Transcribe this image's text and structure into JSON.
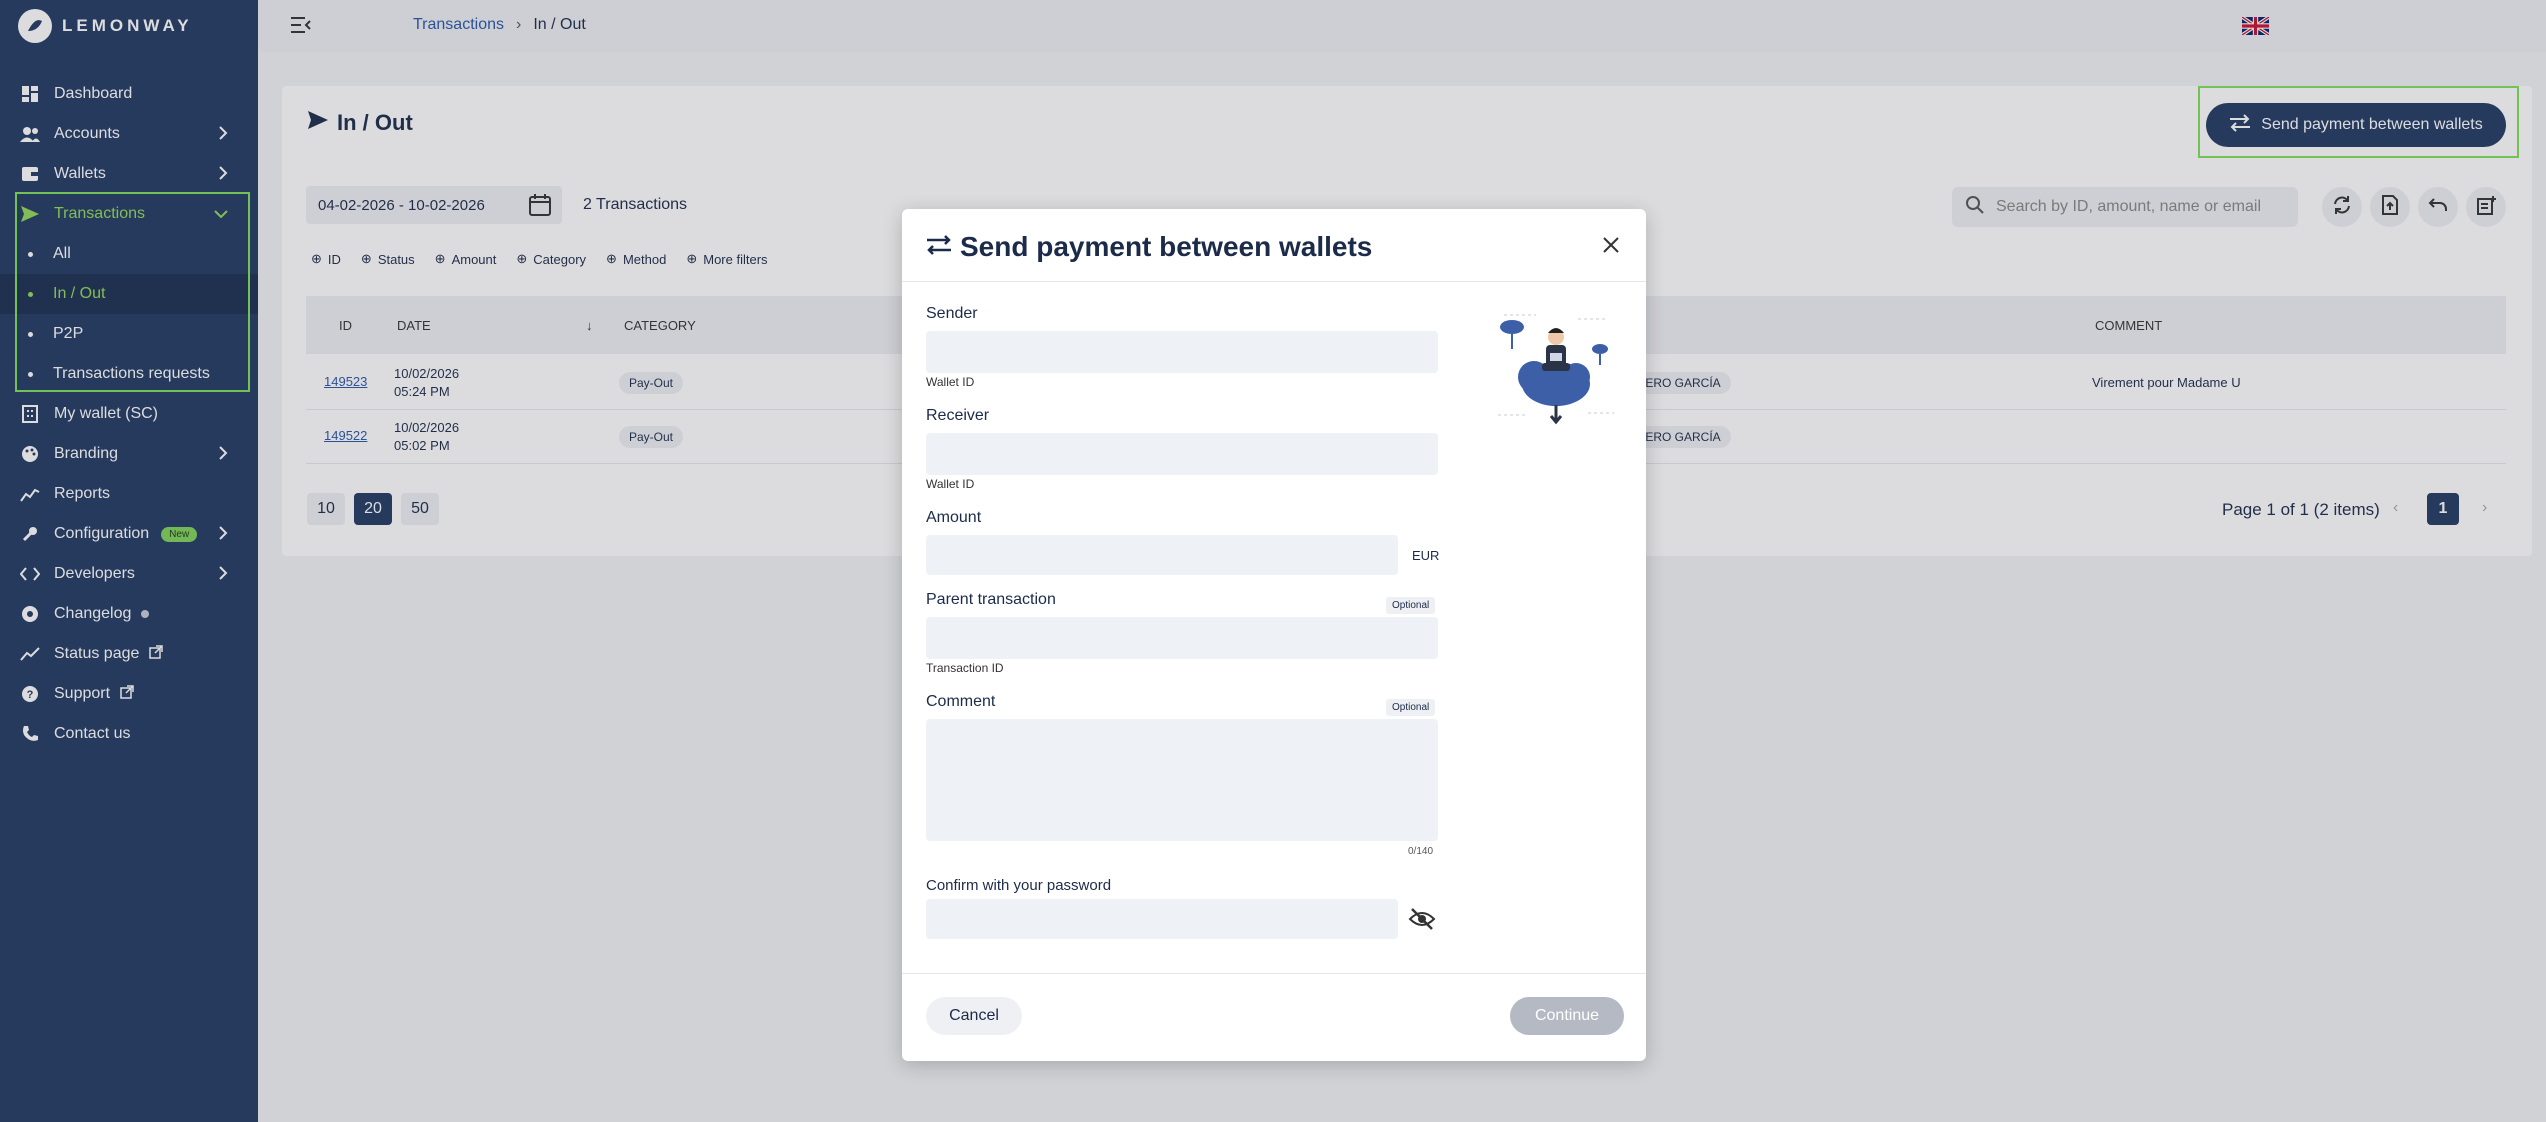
{
  "brand": {
    "name": "LEMONWAY"
  },
  "sidebar": {
    "items": [
      {
        "label": "Dashboard"
      },
      {
        "label": "Accounts"
      },
      {
        "label": "Wallets"
      },
      {
        "label": "Transactions"
      },
      {
        "label": "My wallet (SC)"
      },
      {
        "label": "Branding"
      },
      {
        "label": "Reports"
      },
      {
        "label": "Configuration",
        "badge": "New"
      },
      {
        "label": "Developers"
      },
      {
        "label": "Changelog"
      },
      {
        "label": "Status page"
      },
      {
        "label": "Support"
      },
      {
        "label": "Contact us"
      }
    ],
    "sub_items": [
      {
        "label": "All"
      },
      {
        "label": "In / Out"
      },
      {
        "label": "P2P"
      },
      {
        "label": "Transactions requests"
      }
    ],
    "accent_color": "#93d95a"
  },
  "breadcrumb": {
    "parent": "Transactions",
    "current": "In / Out"
  },
  "page": {
    "title": "In / Out",
    "send_button": "Send payment between wallets",
    "date_range": "04-02-2026 - 10-02-2026",
    "transaction_count": "2 Transactions",
    "search_placeholder": "Search by ID, amount, name or email",
    "filters": [
      "ID",
      "Status",
      "Amount",
      "Category",
      "Method",
      "More filters"
    ]
  },
  "table": {
    "headers": {
      "id": "ID",
      "date": "DATE",
      "category": "CATEGORY",
      "comment": "COMMENT"
    },
    "rows": [
      {
        "id": "149523",
        "date": "10/02/2026",
        "time": "05:24 PM",
        "category": "Pay-Out",
        "name": "OMERO GARCÍA",
        "comment": "Virement pour Madame U"
      },
      {
        "id": "149522",
        "date": "10/02/2026",
        "time": "05:02 PM",
        "category": "Pay-Out",
        "name": "OMERO GARCÍA",
        "comment": ""
      }
    ]
  },
  "pagination": {
    "sizes": [
      "10",
      "20",
      "50"
    ],
    "info": "Page 1 of 1 (2 items)",
    "current": "1"
  },
  "modal": {
    "title": "Send payment between wallets",
    "sender_label": "Sender",
    "sender_hint": "Wallet ID",
    "receiver_label": "Receiver",
    "receiver_hint": "Wallet ID",
    "amount_label": "Amount",
    "currency": "EUR",
    "parent_label": "Parent transaction",
    "parent_optional": "Optional",
    "parent_hint": "Transaction ID",
    "comment_label": "Comment",
    "comment_optional": "Optional",
    "comment_counter": "0/140",
    "password_label": "Confirm with your password",
    "cancel": "Cancel",
    "continue": "Continue"
  }
}
